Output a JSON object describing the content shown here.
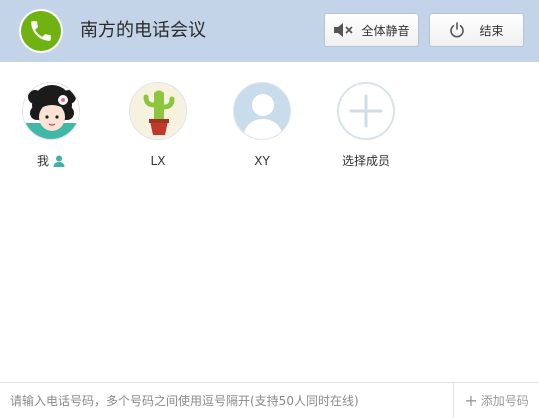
{
  "header": {
    "title": "南方的电话会议",
    "mute_label": "全体静音",
    "end_label": "结束",
    "call_icon": "phone-icon",
    "mute_icon": "speaker-muted-icon",
    "end_icon": "power-icon",
    "colors": {
      "bar": "#c3d4e8",
      "call_icon_bg": "#6fb212"
    }
  },
  "members": [
    {
      "name": "我",
      "avatar": "girl-cartoon-avatar",
      "badge_icon": "person-icon"
    },
    {
      "name": "LX",
      "avatar": "cactus-avatar"
    },
    {
      "name": "XY",
      "avatar": "default-person-avatar"
    }
  ],
  "select_members": {
    "label": "选择成员",
    "icon": "plus-icon"
  },
  "footer": {
    "input_placeholder": "请输入电话号码，多个号码之间使用逗号隔开(支持50人同时在线)",
    "input_value": "",
    "add_label": "添加号码",
    "add_icon": "plus-icon"
  }
}
